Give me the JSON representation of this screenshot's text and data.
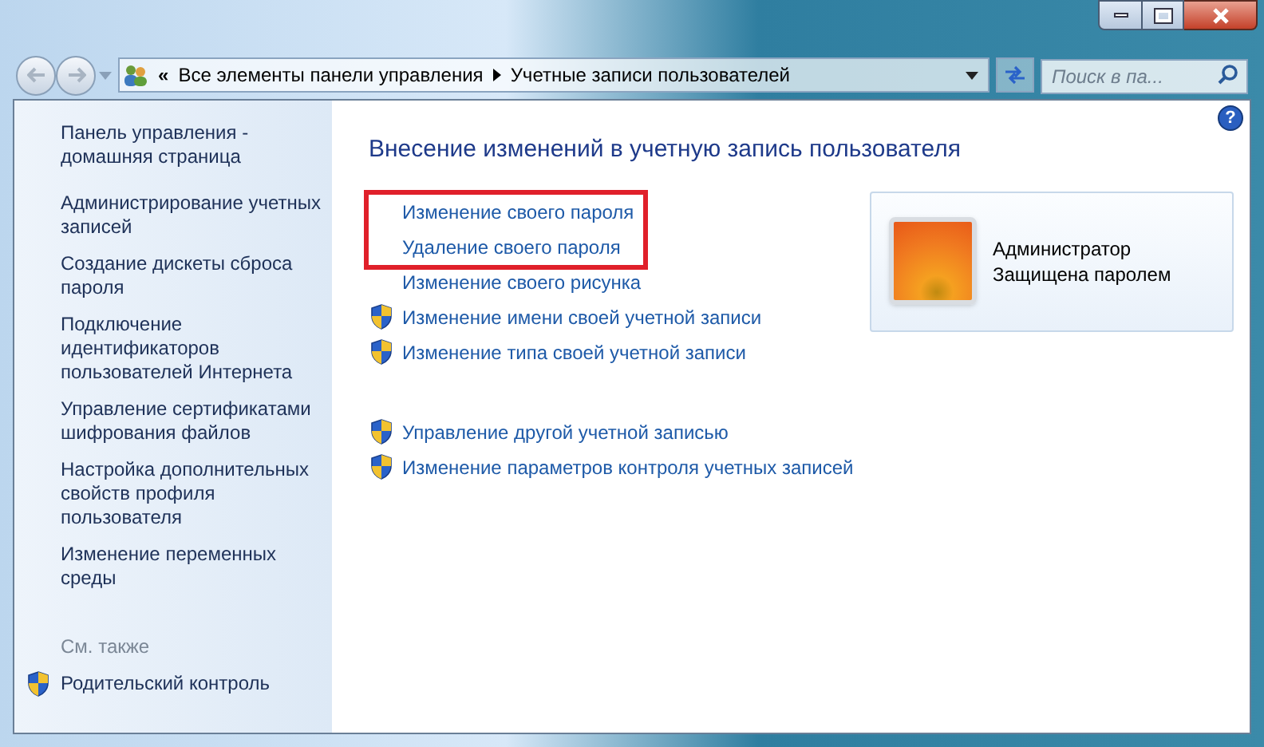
{
  "address_bar": {
    "overflow": "«",
    "crumbs": [
      "Все элементы панели управления",
      "Учетные записи пользователей"
    ]
  },
  "search": {
    "placeholder": "Поиск в па..."
  },
  "sidebar": {
    "home_link": "Панель управления - домашняя страница",
    "items": [
      "Администрирование учетных записей",
      "Создание дискеты сброса пароля",
      "Подключение идентификаторов пользователей Интернета",
      "Управление сертификатами шифрования файлов",
      "Настройка дополнительных свойств профиля пользователя",
      "Изменение переменных среды"
    ],
    "see_also": {
      "title": "См. также",
      "items": [
        {
          "label": "Родительский контроль",
          "shield": true
        }
      ]
    }
  },
  "main": {
    "help": "?",
    "heading": "Внесение изменений в учетную запись пользователя",
    "task_groups": [
      [
        {
          "label": "Изменение своего пароля",
          "shield": false,
          "highlighted": true
        },
        {
          "label": "Удаление своего пароля",
          "shield": false,
          "highlighted": true
        },
        {
          "label": "Изменение своего рисунка",
          "shield": false,
          "highlighted": false
        },
        {
          "label": "Изменение имени своей учетной записи",
          "shield": true,
          "highlighted": false
        },
        {
          "label": "Изменение типа своей учетной записи",
          "shield": true,
          "highlighted": false
        }
      ],
      [
        {
          "label": "Управление другой учетной записью",
          "shield": true,
          "highlighted": false
        },
        {
          "label": "Изменение параметров контроля учетных записей",
          "shield": true,
          "highlighted": false
        }
      ]
    ],
    "account": {
      "role": "Администратор",
      "status": "Защищена паролем"
    }
  }
}
